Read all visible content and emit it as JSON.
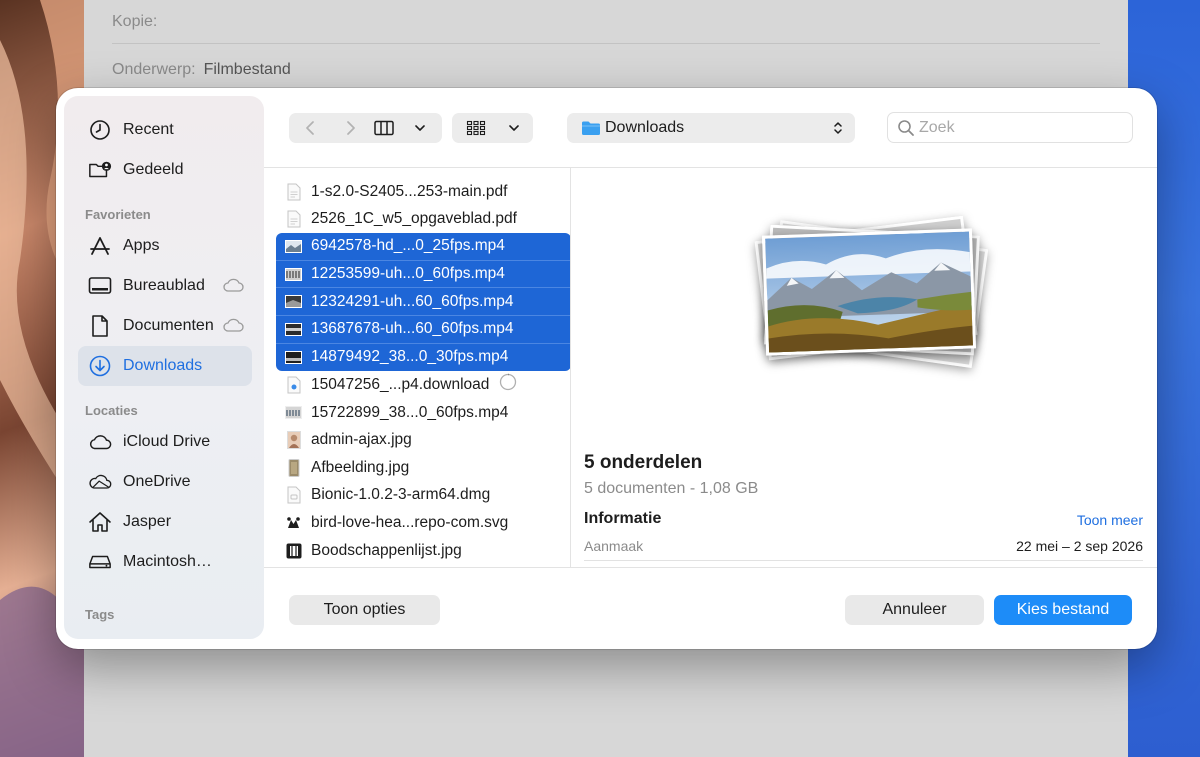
{
  "mail": {
    "cc_label": "Kopie:",
    "subject_label": "Onderwerp:",
    "subject_value": "Filmbestand"
  },
  "sidebar": {
    "items_top": [
      {
        "label": "Recent",
        "icon": "clock-icon"
      },
      {
        "label": "Gedeeld",
        "icon": "shared-folder-icon"
      }
    ],
    "favorites_title": "Favorieten",
    "favorites": [
      {
        "label": "Apps",
        "icon": "apps-icon"
      },
      {
        "label": "Bureaublad",
        "icon": "desktop-icon"
      },
      {
        "label": "Documenten",
        "icon": "document-icon"
      },
      {
        "label": "Downloads",
        "icon": "downloads-icon"
      }
    ],
    "locations_title": "Locaties",
    "locations": [
      {
        "label": "iCloud Drive",
        "icon": "icloud-icon"
      },
      {
        "label": "OneDrive",
        "icon": "onedrive-icon"
      },
      {
        "label": "Jasper",
        "icon": "home-icon"
      },
      {
        "label": "Macintosh HD",
        "icon": "disk-icon"
      }
    ],
    "tags_title": "Tags"
  },
  "toolbar": {
    "location": "Downloads",
    "search_placeholder": "Zoek"
  },
  "files": [
    {
      "name": "1-s2.0-S2405...253-main.pdf",
      "type": "pdf",
      "selected": false
    },
    {
      "name": "2526_1C_w5_opgaveblad.pdf",
      "type": "pdf",
      "selected": false
    },
    {
      "name": "6942578-hd_...0_25fps.mp4",
      "type": "video",
      "selected": true
    },
    {
      "name": "12253599-uh...0_60fps.mp4",
      "type": "video",
      "selected": true
    },
    {
      "name": "12324291-uh...60_60fps.mp4",
      "type": "video",
      "selected": true
    },
    {
      "name": "13687678-uh...60_60fps.mp4",
      "type": "video",
      "selected": true
    },
    {
      "name": "14879492_38...0_30fps.mp4",
      "type": "video",
      "selected": true
    },
    {
      "name": "15047256_...p4.download",
      "type": "download",
      "selected": false
    },
    {
      "name": "15722899_38...0_60fps.mp4",
      "type": "video",
      "selected": false
    },
    {
      "name": "admin-ajax.jpg",
      "type": "image",
      "selected": false
    },
    {
      "name": "Afbeelding.jpg",
      "type": "image2",
      "selected": false
    },
    {
      "name": "Bionic-1.0.2-3-arm64.dmg",
      "type": "dmg",
      "selected": false
    },
    {
      "name": "bird-love-hea...repo-com.svg",
      "type": "svg",
      "selected": false
    },
    {
      "name": "Boodschappenlijst.jpg",
      "type": "image3",
      "selected": false
    }
  ],
  "preview": {
    "count": "5 onderdelen",
    "sub": "5 documenten - 1,08 GB",
    "info_title": "Informatie",
    "more_link": "Toon meer",
    "created_key": "Aanmaak",
    "created_value": "22 mei – 2 sep 2026"
  },
  "footer": {
    "options_label": "Toon opties",
    "cancel_label": "Annuleer",
    "choose_label": "Kies bestand"
  },
  "colors": {
    "accent": "#1f6fe0",
    "selection": "#1e66d6",
    "primary_button": "#1d8cf8"
  }
}
